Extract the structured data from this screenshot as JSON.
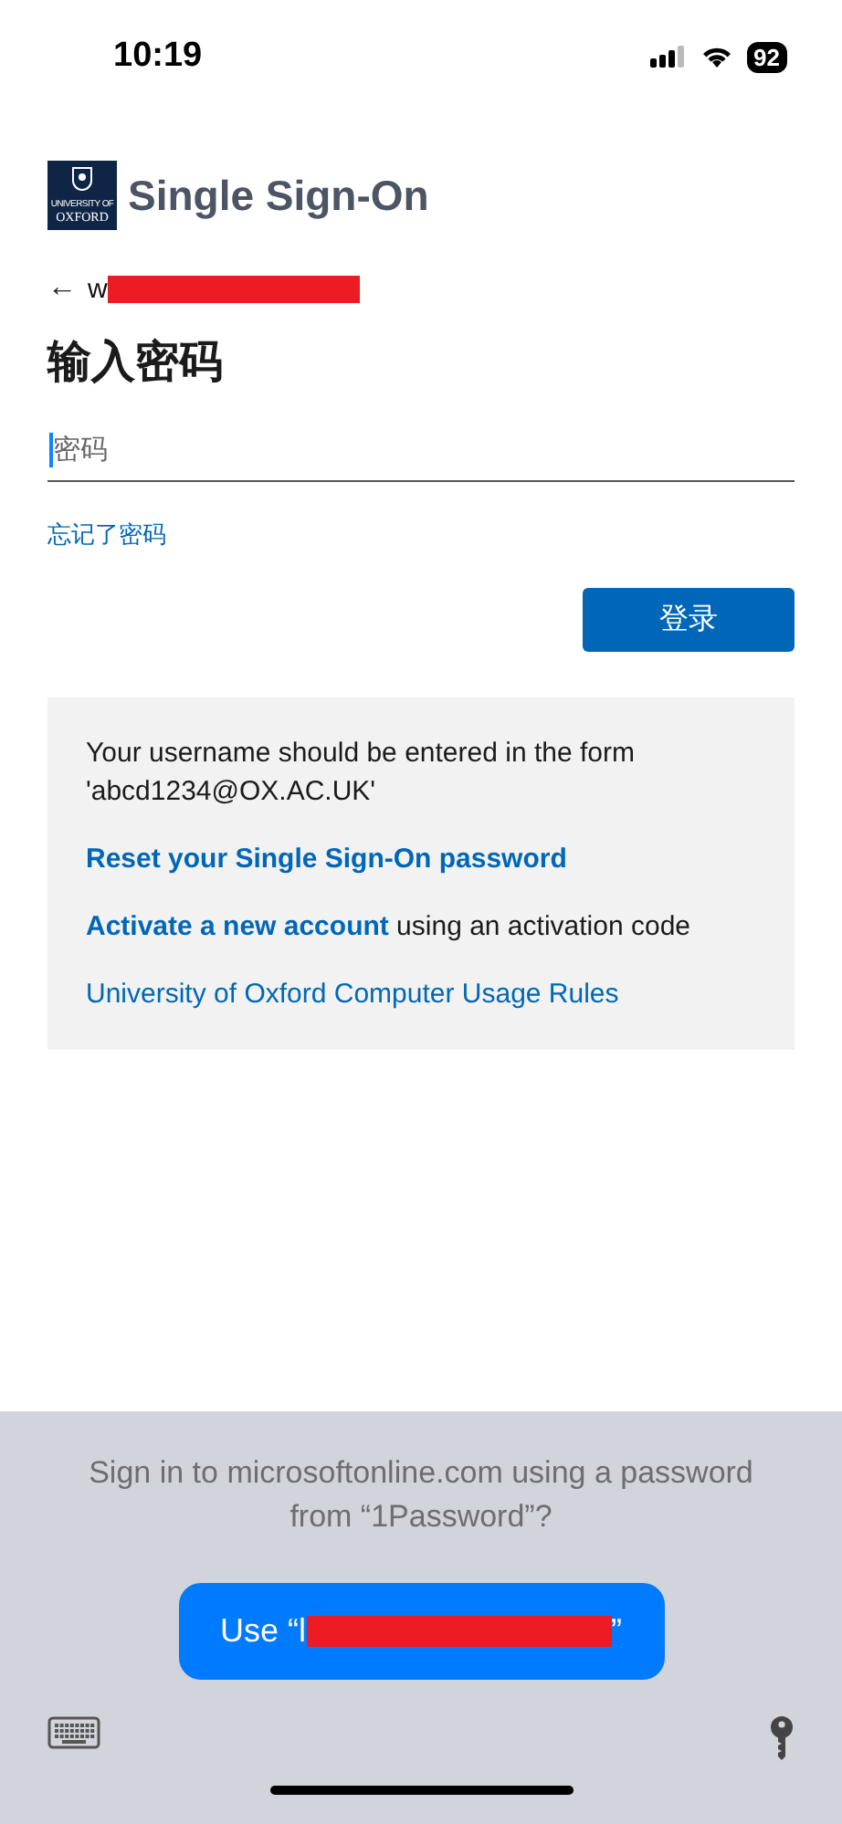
{
  "status_bar": {
    "time": "10:19",
    "battery": "92"
  },
  "header": {
    "logo_lines": [
      "UNIVERSITY OF",
      "OXFORD"
    ],
    "title": "Single Sign-On"
  },
  "account": {
    "back_arrow": "←",
    "username": "w",
    "redacted": true
  },
  "heading": "输入密码",
  "password_field": {
    "placeholder": "密码",
    "focused": true
  },
  "forgot_link": "忘记了密码",
  "sign_in_button": "登录",
  "info_panel": {
    "items": [
      {
        "kind": "text",
        "text": "Your username should be entered in the form 'abcd1234@OX.AC.UK'"
      },
      {
        "kind": "link",
        "text": "Reset your Single Sign-On password",
        "bold": true
      },
      {
        "kind": "link_sentence",
        "link": "Activate a new account",
        "text": " using an activation code"
      },
      {
        "kind": "link",
        "text": "University of Oxford Computer Usage Rules",
        "bold": false
      }
    ]
  },
  "password_prompt": {
    "message": "Sign in to microsoftonline.com using a password from “1Password”?",
    "button_prefix": "Use “l",
    "button_suffix": "”",
    "redacted": true
  }
}
